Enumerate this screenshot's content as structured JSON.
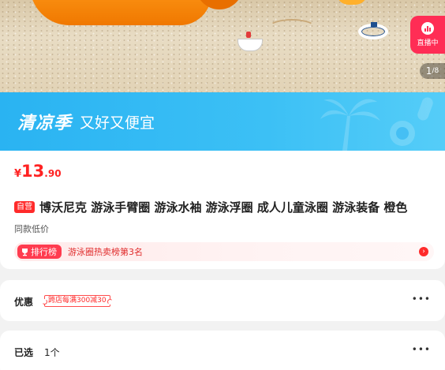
{
  "gallery": {
    "live_badge": "直播中",
    "page_current": "1",
    "page_total": "/8"
  },
  "banner": {
    "season": "清凉季",
    "slogan": "又好又便宜"
  },
  "price": {
    "currency": "¥",
    "integer": "13",
    "decimal": ".90"
  },
  "product": {
    "self_tag": "自营",
    "title": "博沃尼克 游泳手臂圈 游泳水袖 游泳浮圈 成人儿童泳圈 游泳装备 橙色",
    "same_low_price": "同款低价"
  },
  "ranking": {
    "tag": "排行榜",
    "text": "游泳圈热卖榜第3名"
  },
  "discount": {
    "label": "优惠",
    "coupon": "跨店每满300减30"
  },
  "selected": {
    "label": "已选",
    "value": "1个"
  },
  "more_indicator": "•••",
  "colors": {
    "price_red": "#ff2222",
    "banner_blue": "#2ab3f2",
    "live_pink": "#ff2d55",
    "rank_red": "#ff3b4f"
  },
  "icons": {
    "live": "live-chart-icon",
    "trophy": "trophy-icon",
    "arrow": "chevron-right-icon",
    "more": "more-dots-icon"
  }
}
